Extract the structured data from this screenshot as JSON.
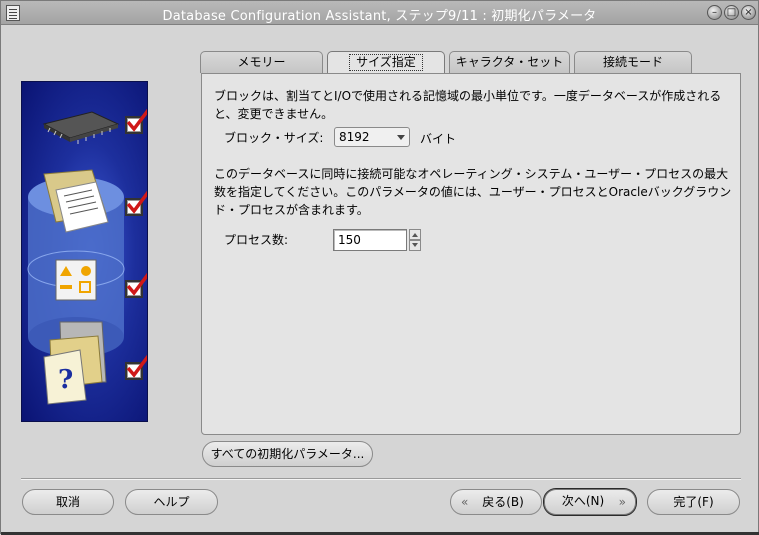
{
  "window": {
    "title": "Database Configuration Assistant, ステップ9/11 : 初期化パラメータ"
  },
  "tabs": [
    {
      "label": "メモリー",
      "active": false
    },
    {
      "label": "サイズ指定",
      "active": true
    },
    {
      "label": "キャラクタ・セット",
      "active": false
    },
    {
      "label": "接続モード",
      "active": false
    }
  ],
  "size_tab": {
    "block_description": "ブロックは、割当てとI/Oで使用される記憶域の最小単位です。一度データベースが作成されると、変更できません。",
    "block_size_label": "ブロック・サイズ:",
    "block_size_value": "8192",
    "block_size_unit": "バイト",
    "process_description": "このデータベースに同時に接続可能なオペレーティング・システム・ユーザー・プロセスの最大数を指定してください。このパラメータの値には、ユーザー・プロセスとOracleバックグラウンド・プロセスが含まれます。",
    "processes_label": "プロセス数:",
    "processes_value": "150"
  },
  "buttons": {
    "all_init_params": "すべての初期化パラメータ...",
    "cancel": "取消",
    "help": "ヘルプ",
    "back": "戻る(B)",
    "next": "次へ(N)",
    "finish": "完了(F)"
  },
  "colors": {
    "side_panel": "#1d2f9d",
    "check_mark": "#d01818"
  }
}
